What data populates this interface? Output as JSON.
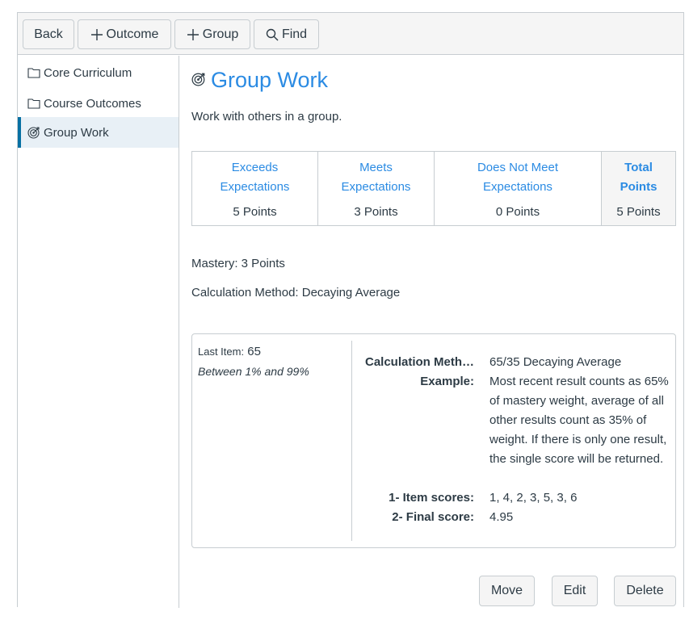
{
  "toolbar": {
    "back_label": "Back",
    "outcome_label": "Outcome",
    "group_label": "Group",
    "find_label": "Find"
  },
  "sidebar": {
    "items": [
      {
        "label": "Core Curriculum",
        "icon": "folder-icon"
      },
      {
        "label": "Course Outcomes",
        "icon": "folder-icon"
      },
      {
        "label": "Group Work",
        "icon": "outcome-target-icon"
      }
    ]
  },
  "outcome": {
    "title": "Group Work",
    "description": "Work with others in a group.",
    "rubric": [
      {
        "description": "Exceeds Expectations",
        "points": "5 Points"
      },
      {
        "description": "Meets Expectations",
        "points": "3 Points"
      },
      {
        "description": "Does Not Meet Expectations",
        "points": "0 Points"
      },
      {
        "description": "Total Points",
        "points": "5 Points"
      }
    ],
    "mastery": "Mastery: 3 Points",
    "calculation_method": "Calculation Method: Decaying Average"
  },
  "calc_box": {
    "last_item_label": "Last Item:",
    "last_item_value": "65",
    "range": "Between 1% and 99%",
    "rows": [
      {
        "label": "Calculation Meth…",
        "value": "65/35 Decaying Average"
      },
      {
        "label": "Example:",
        "value": "Most recent result counts as 65% of mastery weight, average of all other results count as 35% of weight. If there is only one result, the single score will be returned."
      },
      {
        "label": "1- Item scores:",
        "value": "1, 4, 2, 3, 5, 3, 6"
      },
      {
        "label": "2- Final score:",
        "value": "4.95"
      }
    ]
  },
  "actions": {
    "move_label": "Move",
    "edit_label": "Edit",
    "delete_label": "Delete"
  },
  "colors": {
    "accent": "#2b8be3",
    "active_border": "#0770a3",
    "active_bg": "#e8f0f6",
    "text": "#2d3b45"
  }
}
